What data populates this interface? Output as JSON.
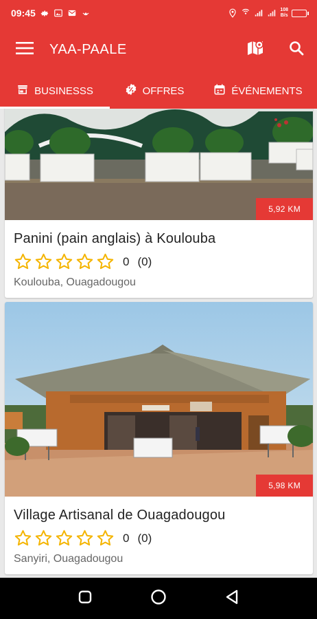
{
  "status_bar": {
    "time": "09:45",
    "net_speed_value": "108",
    "net_speed_unit": "B/s",
    "battery_level": 0.9
  },
  "toolbar": {
    "title": "YAA-PAALE",
    "icons": [
      "menu-icon",
      "map-icon",
      "search-icon"
    ]
  },
  "tabs": [
    {
      "label": "BUSINESSS",
      "icon": "store-icon",
      "active": true
    },
    {
      "label": "OFFRES",
      "icon": "discount-icon",
      "active": false
    },
    {
      "label": "ÉVÉNEMENTS",
      "icon": "calendar-icon",
      "active": false
    }
  ],
  "listings": [
    {
      "name": "Panini (pain anglais) à Koulouba",
      "rating": "0",
      "rating_count": "(0)",
      "address": "Koulouba, Ouagadougou",
      "distance": "5,92 KM"
    },
    {
      "name": "Village Artisanal de Ouagadougou",
      "rating": "0",
      "rating_count": "(0)",
      "address": "Sanyiri, Ouagadougou",
      "distance": "5,98 KM"
    }
  ],
  "colors": {
    "accent": "#e53935",
    "star": "#f4b400",
    "text_primary": "#222222",
    "text_secondary": "#666666"
  }
}
